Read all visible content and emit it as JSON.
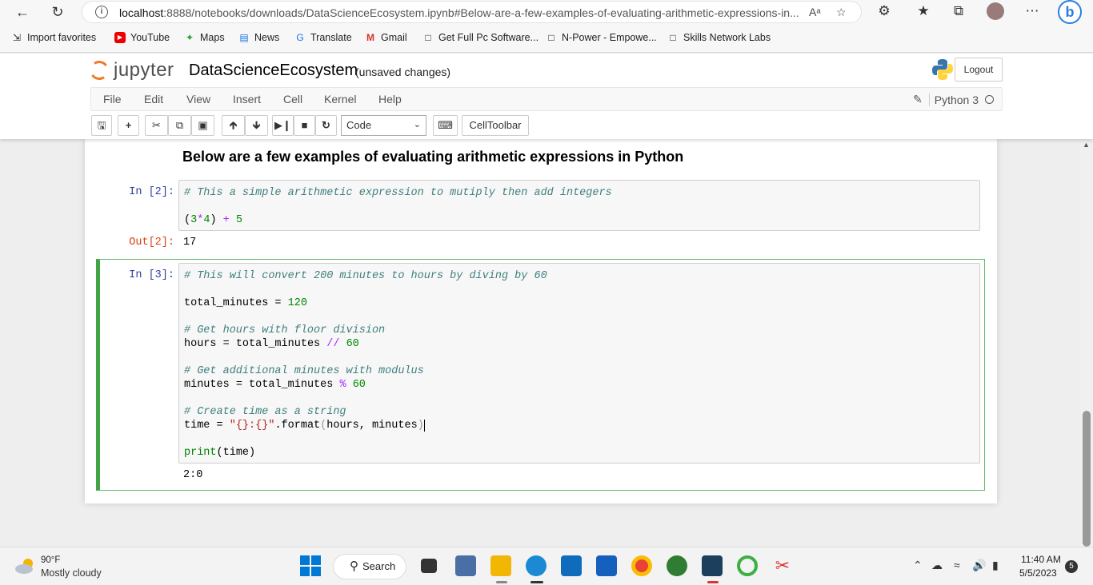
{
  "browser": {
    "url_host": "localhost",
    "url_path": ":8888/notebooks/downloads/DataScienceEcosystem.ipynb#Below-are-a-few-examples-of-evaluating-arithmetic-expressions-in...",
    "read_aloud_icon": "Aᵃ",
    "favorites": [
      {
        "label": "Import favorites",
        "icon": "import-icon"
      },
      {
        "label": "YouTube",
        "icon": "youtube-icon"
      },
      {
        "label": "Maps",
        "icon": "maps-icon"
      },
      {
        "label": "News",
        "icon": "news-icon"
      },
      {
        "label": "Translate",
        "icon": "translate-icon"
      },
      {
        "label": "Gmail",
        "icon": "gmail-icon"
      },
      {
        "label": "Get Full Pc Software...",
        "icon": "page-icon"
      },
      {
        "label": "N-Power - Empowe...",
        "icon": "page-icon"
      },
      {
        "label": "Skills Network Labs",
        "icon": "page-icon"
      }
    ]
  },
  "jupyter": {
    "logo_text": "jupyter",
    "notebook_name": "DataScienceEcosystem",
    "save_status": "(unsaved changes)",
    "logout_label": "Logout",
    "menu": [
      "File",
      "Edit",
      "View",
      "Insert",
      "Cell",
      "Kernel",
      "Help"
    ],
    "kernel_name": "Python 3",
    "cell_type": "Code",
    "celltoolbar_label": "CellToolbar",
    "accent_color": "#f37726",
    "selected_cell_color": "#66bb6a"
  },
  "cells": {
    "heading": "Below are a few examples of evaluating arithmetic expressions in Python",
    "cell1": {
      "in_prompt": "In [2]:",
      "comment": "# This a simple arithmetic expression to mutiply then add integers",
      "code_a": "(",
      "num1": "3",
      "op1": "*",
      "num2": "4",
      "code_b": ") ",
      "op2": "+",
      "num3": "5",
      "out_prompt": "Out[2]:",
      "output": "17"
    },
    "cell2": {
      "in_prompt": "In [3]:",
      "comment1": "# This will convert 200 minutes to hours by diving by 60",
      "var_total": "total_minutes",
      "eq": " = ",
      "num_120": "120",
      "comment2": "# Get hours with floor division",
      "var_hours": "hours",
      "op_floor": "//",
      "num_60a": "60",
      "comment3": "# Get additional minutes with modulus",
      "var_minutes": "minutes",
      "op_mod": "%",
      "num_60b": "60",
      "comment4": "# Create time as a string",
      "var_time": "time",
      "str_fmt": "\"{}:{}\"",
      "format_call": ".format",
      "paren_open": "(",
      "format_args": "hours, minutes",
      "paren_close": ")",
      "print_kw": "print",
      "print_args": "(time)",
      "output": "2:0"
    }
  },
  "taskbar": {
    "weather_temp": "90°F",
    "weather_desc": "Mostly cloudy",
    "search_label": "Search",
    "time": "11:40 AM",
    "date": "5/5/2023",
    "notification_count": "5"
  }
}
